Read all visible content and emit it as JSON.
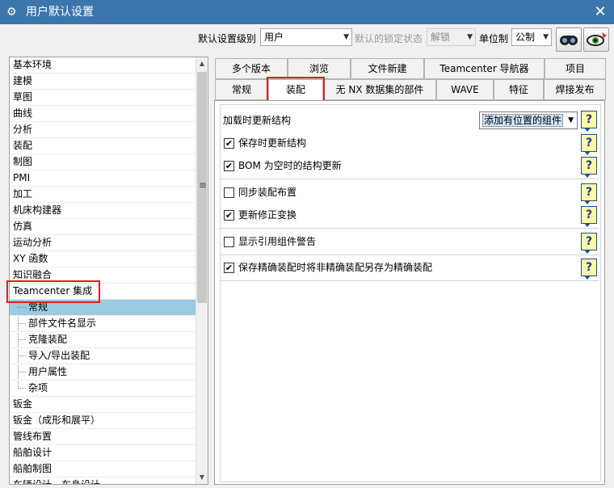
{
  "window": {
    "title": "用户默认设置",
    "close_glyph": "✕"
  },
  "toolbar": {
    "level_label": "默认设置级别",
    "level_value": "用户",
    "lock_label": "默认的锁定状态",
    "lock_value": "解锁",
    "unit_label": "单位制",
    "unit_value": "公制",
    "button1_icon": "binoculars-search-icon",
    "button2_icon": "eye-manager-icon"
  },
  "tree": {
    "items": [
      {
        "label": "基本环境"
      },
      {
        "label": "建模"
      },
      {
        "label": "草图"
      },
      {
        "label": "曲线"
      },
      {
        "label": "分析"
      },
      {
        "label": "装配"
      },
      {
        "label": "制图"
      },
      {
        "label": "PMI"
      },
      {
        "label": "加工"
      },
      {
        "label": "机床构建器"
      },
      {
        "label": "仿真"
      },
      {
        "label": "运动分析"
      },
      {
        "label": "XY 函数"
      },
      {
        "label": "知识融合"
      },
      {
        "label": "Teamcenter 集成"
      },
      {
        "label": "常规"
      },
      {
        "label": "部件文件名显示"
      },
      {
        "label": "克隆装配"
      },
      {
        "label": "导入/导出装配"
      },
      {
        "label": "用户属性"
      },
      {
        "label": "杂项"
      },
      {
        "label": "钣金"
      },
      {
        "label": "钣金（成形和展平）"
      },
      {
        "label": "管线布置"
      },
      {
        "label": "船舶设计"
      },
      {
        "label": "船舶制图"
      },
      {
        "label": "车辆设计 - 车身设计"
      }
    ]
  },
  "tabs": {
    "row1": [
      "多个版本",
      "浏览",
      "文件新建",
      "Teamcenter 导航器",
      "项目"
    ],
    "row2": [
      "常规",
      "装配",
      "无 NX 数据集的部件",
      "WAVE",
      "特征",
      "焊接发布"
    ],
    "active": "装配"
  },
  "settings": {
    "update_structure_label": "加载时更新结构",
    "update_structure_value": "添加有位置的组件",
    "save_update_label": "保存时更新结构",
    "bom_empty_label": "BOM 为空时的结构更新",
    "sync_layout_label": "同步装配布置",
    "update_transform_label": "更新修正变换",
    "ref_warning_label": "显示引用组件警告",
    "save_precise_label": "保存精确装配时将非精确装配另存为精确装配",
    "help_glyph": "?",
    "check_glyph": "✔"
  }
}
